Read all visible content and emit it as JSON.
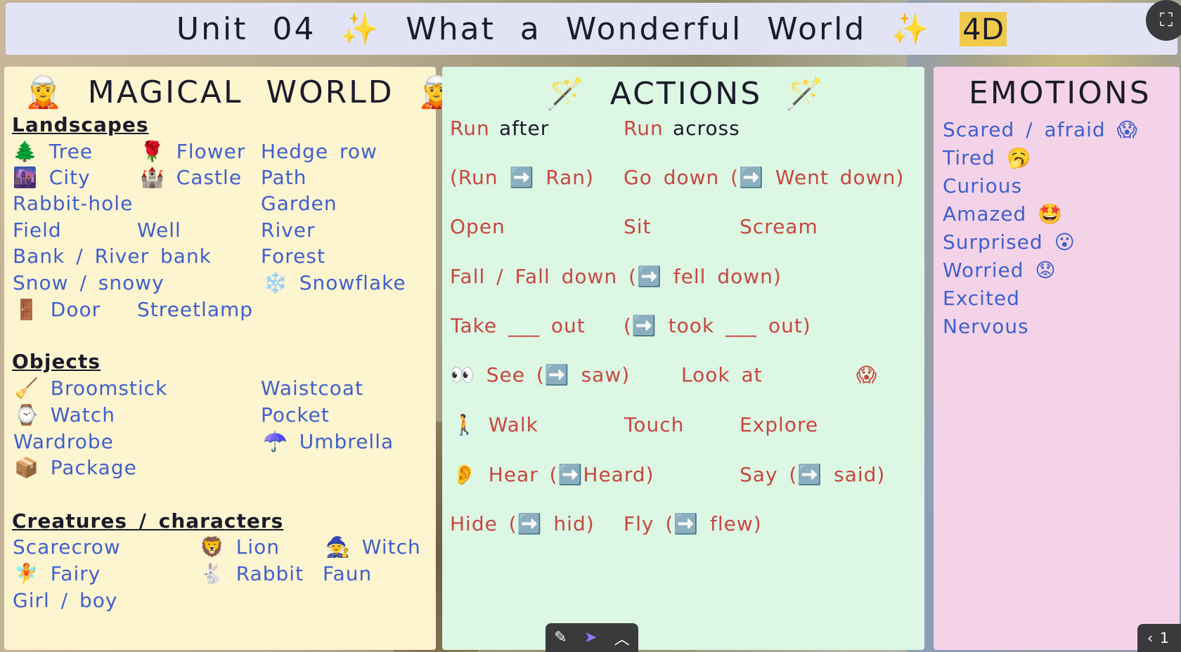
{
  "header": {
    "title": "Unit 04 ✨ What a Wonderful World ✨",
    "badge": "4D",
    "fullscreen_icon": "fullscreen-icon"
  },
  "magical_world": {
    "title": "🧝 MAGICAL WORLD 🧝",
    "landscapes_heading": "Landscapes",
    "landscapes": [
      "🌲 Tree",
      "🌹 Flower",
      "Hedge row",
      "🌆 City",
      "🏰 Castle",
      "Path",
      "Rabbit-hole",
      "Garden",
      "Field",
      "Well",
      "River",
      "Bank / River bank",
      "Forest",
      "Snow / snowy",
      "❄️ Snowflake",
      "🚪 Door",
      "Streetlamp"
    ],
    "objects_heading": "Objects",
    "objects": [
      "🧹 Broomstick",
      "Waistcoat",
      "⌚ Watch",
      "Pocket",
      "Wardrobe",
      "☂️ Umbrella",
      "📦 Package"
    ],
    "creatures_heading": "Creatures / characters",
    "creatures": [
      "Scarecrow",
      "🦁 Lion",
      "🧙 Witch",
      "🧚 Fairy",
      "🐇 Rabbit",
      "Faun",
      "Girl / boy"
    ]
  },
  "actions": {
    "title": "🪄 ACTIONS 🪄",
    "items": [
      "Run",
      "after",
      "Run",
      "across",
      "(Run ➡️ Ran)",
      "Go down (➡️ Went down)",
      "Open",
      "Sit",
      "Scream",
      "Fall / Fall down (➡️ fell down)",
      "Take ___ out",
      "(➡️ took ___ out)",
      "👀 See (➡️ saw)",
      "Look at",
      "😱",
      "🚶 Walk",
      "Touch",
      "Explore",
      "👂 Hear (➡️Heard)",
      "Say (➡️ said)",
      "Hide (➡️ hid)",
      "Fly (➡️ flew)"
    ]
  },
  "emotions": {
    "title": "EMOTIONS",
    "items": [
      "Scared / afraid 😱",
      "Tired 🥱",
      "Curious",
      "Amazed 🤩",
      "Surprised 😮",
      "Worried 😟",
      "Excited",
      "Nervous"
    ]
  },
  "toolbar": {
    "pen_icon": "pen-icon",
    "pointer_icon": "pointer-icon",
    "chevron_icon": "chevron-up-icon"
  },
  "pager": {
    "prev_icon": "chevron-left-icon",
    "page": "1"
  }
}
